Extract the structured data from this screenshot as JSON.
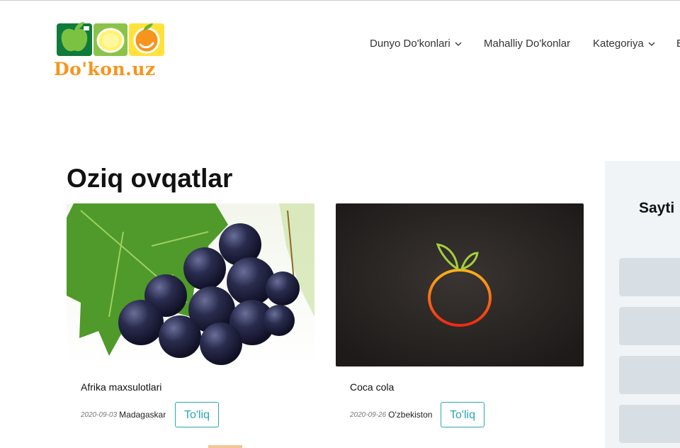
{
  "logo": {
    "text": "Do'kon.uz"
  },
  "nav": {
    "items": [
      {
        "label": "Dunyo Do'konlari",
        "has_dropdown": true
      },
      {
        "label": "Mahalliy Do'konlar",
        "has_dropdown": false
      },
      {
        "label": "Kategoriya",
        "has_dropdown": true
      },
      {
        "label": "B",
        "has_dropdown": false
      }
    ]
  },
  "main": {
    "title": "Oziq ovqatlar",
    "cards": [
      {
        "image": "grapes-image",
        "title": "Afrika maxsulotlari",
        "date": "2020-09-03",
        "origin": "Madagaskar",
        "button": "To'liq"
      },
      {
        "image": "orange-logo-image",
        "title": "Coca cola",
        "date": "2020-09-26",
        "origin": "O'zbekiston",
        "button": "To'liq"
      }
    ]
  },
  "sidebar": {
    "title": "Sayti"
  },
  "colors": {
    "accent": "#2aa6b2",
    "logo_orange": "#f7941d",
    "logo_green": "#6ab42d",
    "sidebar_bg": "#f0f4f7",
    "sidebar_block": "#d7dfe4"
  }
}
